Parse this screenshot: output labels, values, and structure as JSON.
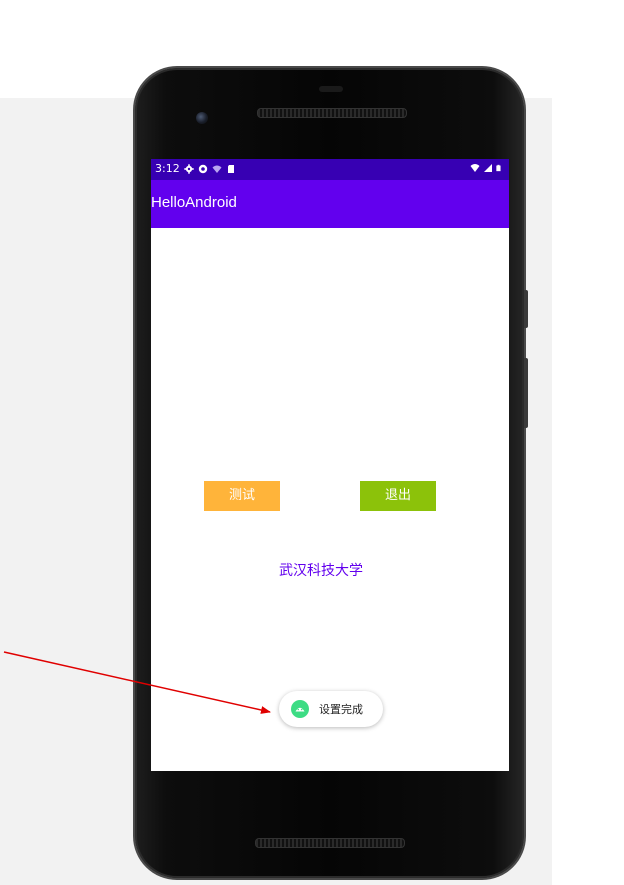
{
  "status_bar": {
    "time": "3:12",
    "icons_left": [
      "gear-icon",
      "shield-icon",
      "wifi-off-icon",
      "sd-card-icon"
    ],
    "icons_right": [
      "wifi-icon",
      "signal-icon",
      "battery-icon"
    ]
  },
  "app_bar": {
    "title": "HelloAndroid"
  },
  "buttons": {
    "test_label": "测试",
    "exit_label": "退出"
  },
  "content": {
    "university_text": "武汉科技大学"
  },
  "toast": {
    "icon": "android-icon",
    "message": "设置完成"
  },
  "colors": {
    "status_bar": "#3700b3",
    "app_bar": "#6200ee",
    "test_button": "#ffb43a",
    "exit_button": "#8cc20a",
    "text_accent": "#6200ee",
    "annotation_arrow": "#e00000"
  },
  "annotation": {
    "icon": "red-arrow-icon"
  }
}
